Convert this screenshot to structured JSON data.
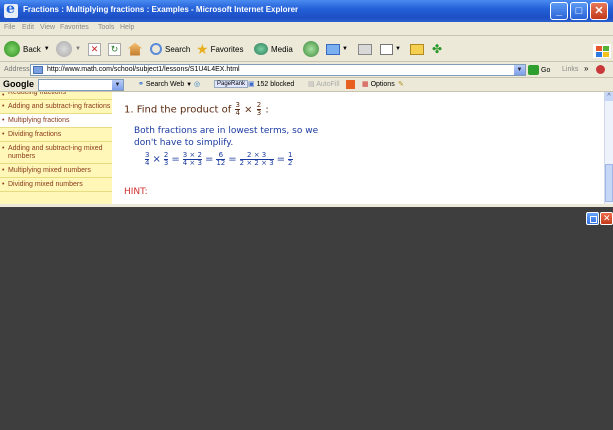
{
  "window": {
    "title": "Fractions : Multiplying fractions : Examples - Microsoft Internet Explorer"
  },
  "menu": [
    "File",
    "Edit",
    "View",
    "Favorites",
    "Tools",
    "Help"
  ],
  "toolbar": {
    "back_label": "Back",
    "search_label": "Search",
    "favorites_label": "Favorites",
    "media_label": "Media"
  },
  "address": {
    "label": "Address",
    "url": "http://www.math.com/school/subject1/lessons/S1U4L4EX.html",
    "go_label": "Go",
    "links_label": "Links"
  },
  "googlebar": {
    "brand": "Google",
    "search_web": "Search Web",
    "pagerank": "PageRank",
    "blocked": "152 blocked",
    "autofill": "AutoFill",
    "options": "Options"
  },
  "sidebar": {
    "items": [
      {
        "label": "Reducing fractions"
      },
      {
        "label": "Adding and subtract-ing fractions"
      },
      {
        "label": "Multiplying fractions"
      },
      {
        "label": "Dividing fractions"
      },
      {
        "label": "Adding and subtract-ing mixed numbers"
      },
      {
        "label": "Multiplying mixed numbers"
      },
      {
        "label": "Dividing mixed numbers"
      }
    ]
  },
  "lesson": {
    "question_prefix": "1. Find the product of",
    "q_frac1": {
      "n": "3",
      "d": "4"
    },
    "times": "×",
    "q_frac2": {
      "n": "2",
      "d": "3"
    },
    "colon": ":",
    "explanation_line1": "Both fractions are in lowest terms, so we",
    "explanation_line2": "don't have to simplify.",
    "eq": {
      "f1": {
        "n": "3",
        "d": "4"
      },
      "f2": {
        "n": "2",
        "d": "3"
      },
      "f3": {
        "n": "3 × 2",
        "d": "4 × 3"
      },
      "f4": {
        "n": "6",
        "d": "12"
      },
      "f5": {
        "n": "2 × 3",
        "d": "2 × 2 × 3"
      },
      "f6": {
        "n": "1",
        "d": "2"
      },
      "times": "×",
      "equals": "="
    },
    "hint": "HINT:"
  },
  "colors": {
    "titlebar": "#2460d8",
    "sidebar_bg": "#fff7b8",
    "sidebar_text": "#8a3a1a",
    "lesson_text": "#1a3aa0",
    "hint": "#d03030",
    "desktop": "#3e3e3e"
  }
}
